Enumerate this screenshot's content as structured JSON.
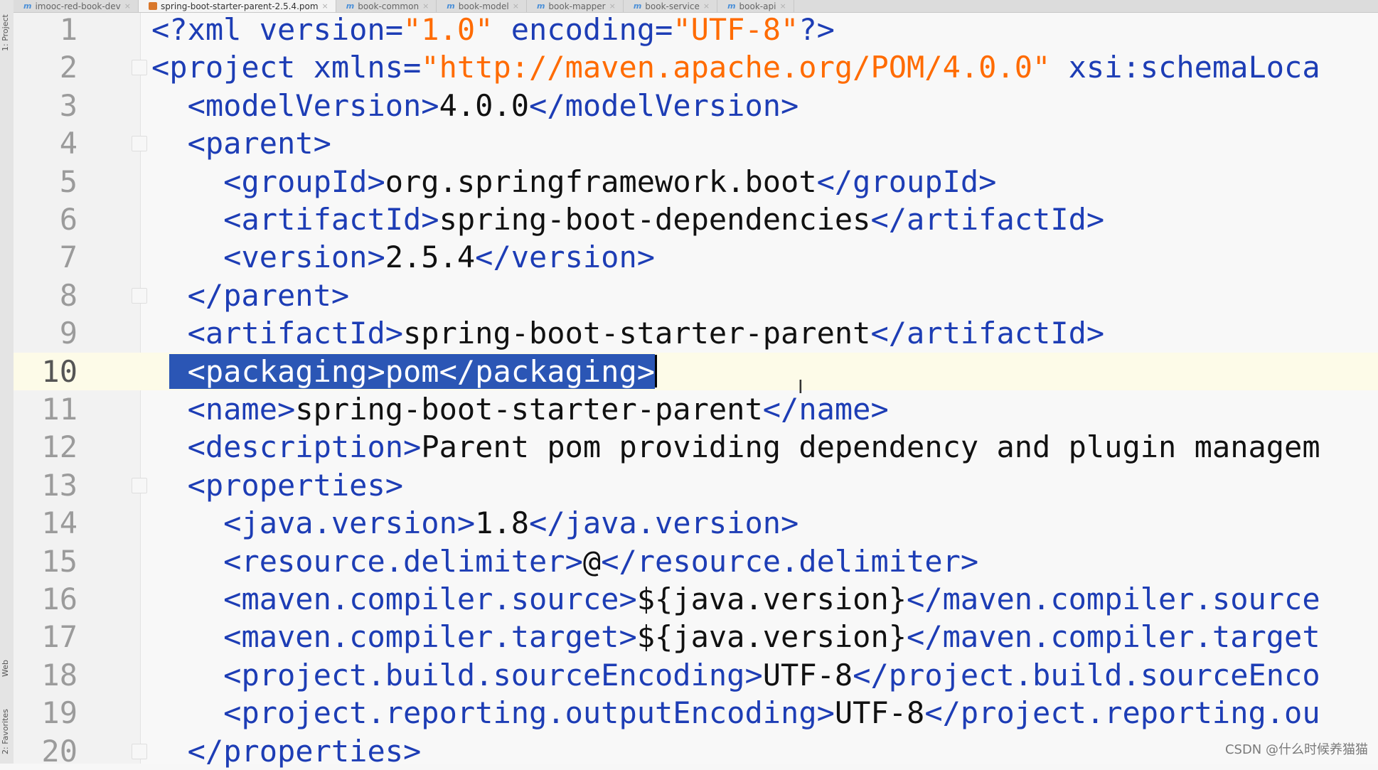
{
  "toolstrip": {
    "project": "1: Project",
    "web": "Web",
    "favorites": "2: Favorites"
  },
  "tabs": [
    {
      "label": "imooc-red-book-dev",
      "icon": "module-icon",
      "active": false
    },
    {
      "label": "spring-boot-starter-parent-2.5.4.pom",
      "icon": "xml-file-icon",
      "active": true
    },
    {
      "label": "book-common",
      "icon": "module-icon",
      "active": false
    },
    {
      "label": "book-model",
      "icon": "module-icon",
      "active": false
    },
    {
      "label": "book-mapper",
      "icon": "module-icon",
      "active": false
    },
    {
      "label": "book-service",
      "icon": "module-icon",
      "active": false
    },
    {
      "label": "book-api",
      "icon": "module-icon",
      "active": false
    }
  ],
  "editor": {
    "current_line": 10,
    "lines": [
      {
        "n": "1",
        "indent": "",
        "tokens": [
          [
            "t",
            "<?xml version="
          ],
          [
            "v",
            "\"1.0\""
          ],
          [
            "t",
            " encoding="
          ],
          [
            "v",
            "\"UTF-8\""
          ],
          [
            "t",
            "?>"
          ]
        ]
      },
      {
        "n": "2",
        "indent": "",
        "tokens": [
          [
            "t",
            "<project xmlns="
          ],
          [
            "v",
            "\"http://maven.apache.org/POM/4.0.0\""
          ],
          [
            "t",
            " xsi:schemaLoca"
          ]
        ]
      },
      {
        "n": "3",
        "indent": "  ",
        "tokens": [
          [
            "t",
            "<modelVersion>"
          ],
          [
            "tx",
            "4.0.0"
          ],
          [
            "t",
            "</modelVersion>"
          ]
        ]
      },
      {
        "n": "4",
        "indent": "  ",
        "tokens": [
          [
            "t",
            "<parent>"
          ]
        ]
      },
      {
        "n": "5",
        "indent": "    ",
        "tokens": [
          [
            "t",
            "<groupId>"
          ],
          [
            "tx",
            "org.springframework.boot"
          ],
          [
            "t",
            "</groupId>"
          ]
        ]
      },
      {
        "n": "6",
        "indent": "    ",
        "tokens": [
          [
            "t",
            "<artifactId>"
          ],
          [
            "tx",
            "spring-boot-dependencies"
          ],
          [
            "t",
            "</artifactId>"
          ]
        ]
      },
      {
        "n": "7",
        "indent": "    ",
        "tokens": [
          [
            "t",
            "<version>"
          ],
          [
            "tx",
            "2.5.4"
          ],
          [
            "t",
            "</version>"
          ]
        ]
      },
      {
        "n": "8",
        "indent": "  ",
        "tokens": [
          [
            "t",
            "</parent>"
          ]
        ]
      },
      {
        "n": "9",
        "indent": "  ",
        "tokens": [
          [
            "t",
            "<artifactId>"
          ],
          [
            "tx",
            "spring-boot-starter-parent"
          ],
          [
            "t",
            "</artifactId>"
          ]
        ]
      },
      {
        "n": "10",
        "indent": " ",
        "tokens": [
          [
            "sel",
            " <packaging>pom</packaging>"
          ]
        ]
      },
      {
        "n": "11",
        "indent": "  ",
        "tokens": [
          [
            "t",
            "<name>"
          ],
          [
            "tx",
            "spring-boot-starter-parent"
          ],
          [
            "t",
            "</name>"
          ]
        ]
      },
      {
        "n": "12",
        "indent": "  ",
        "tokens": [
          [
            "t",
            "<description>"
          ],
          [
            "tx",
            "Parent pom providing dependency and plugin managem"
          ]
        ]
      },
      {
        "n": "13",
        "indent": "  ",
        "tokens": [
          [
            "t",
            "<properties>"
          ]
        ]
      },
      {
        "n": "14",
        "indent": "    ",
        "tokens": [
          [
            "t",
            "<java.version>"
          ],
          [
            "tx",
            "1.8"
          ],
          [
            "t",
            "</java.version>"
          ]
        ]
      },
      {
        "n": "15",
        "indent": "    ",
        "tokens": [
          [
            "t",
            "<resource.delimiter>"
          ],
          [
            "tx",
            "@"
          ],
          [
            "t",
            "</resource.delimiter>"
          ]
        ]
      },
      {
        "n": "16",
        "indent": "    ",
        "tokens": [
          [
            "t",
            "<maven.compiler.source>"
          ],
          [
            "tx",
            "${java.version}"
          ],
          [
            "t",
            "</maven.compiler.source"
          ]
        ]
      },
      {
        "n": "17",
        "indent": "    ",
        "tokens": [
          [
            "t",
            "<maven.compiler.target>"
          ],
          [
            "tx",
            "${java.version}"
          ],
          [
            "t",
            "</maven.compiler.target"
          ]
        ]
      },
      {
        "n": "18",
        "indent": "    ",
        "tokens": [
          [
            "t",
            "<project.build.sourceEncoding>"
          ],
          [
            "tx",
            "UTF-8"
          ],
          [
            "t",
            "</project.build.sourceEnco"
          ]
        ]
      },
      {
        "n": "19",
        "indent": "    ",
        "tokens": [
          [
            "t",
            "<project.reporting.outputEncoding>"
          ],
          [
            "tx",
            "UTF-8"
          ],
          [
            "t",
            "</project.reporting.ou"
          ]
        ]
      },
      {
        "n": "20",
        "indent": "  ",
        "tokens": [
          [
            "t",
            "</properties>"
          ]
        ]
      }
    ],
    "fold_lines": [
      "2",
      "4",
      "8",
      "13",
      "20"
    ]
  },
  "watermark": "CSDN @什么时候养猫猫",
  "colors": {
    "tag": "#1d3db5",
    "attr_value": "#ff6b00",
    "text": "#111111",
    "selection": "#2b56b5",
    "current_line": "#fdfbe8"
  }
}
